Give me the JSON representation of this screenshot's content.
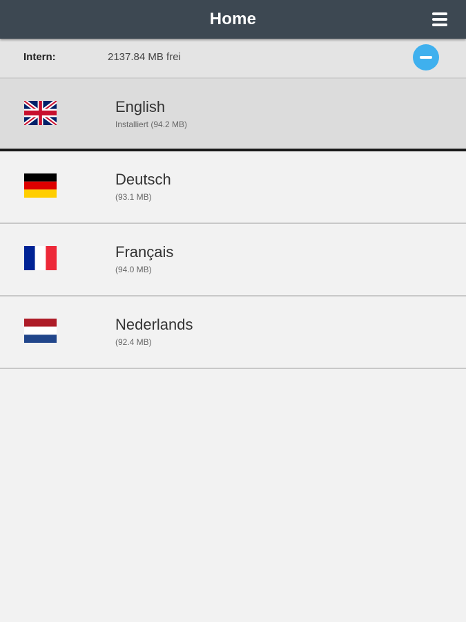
{
  "header": {
    "title": "Home",
    "menu_icon": "hamburger-menu-icon",
    "background": "#3d4852"
  },
  "storage": {
    "label": "Intern:",
    "value": "2137.84 MB frei",
    "remove_icon": "minus-circle-icon",
    "accent": "#3fb0ee"
  },
  "languages": [
    {
      "name": "English",
      "size": "Installiert (94.2 MB)",
      "flag": "uk-flag-icon",
      "selected": true
    },
    {
      "name": "Deutsch",
      "size": "(93.1 MB)",
      "flag": "germany-flag-icon",
      "selected": false
    },
    {
      "name": "Français",
      "size": "(94.0 MB)",
      "flag": "france-flag-icon",
      "selected": false
    },
    {
      "name": "Nederlands",
      "size": "(92.4 MB)",
      "flag": "netherlands-flag-icon",
      "selected": false
    }
  ]
}
